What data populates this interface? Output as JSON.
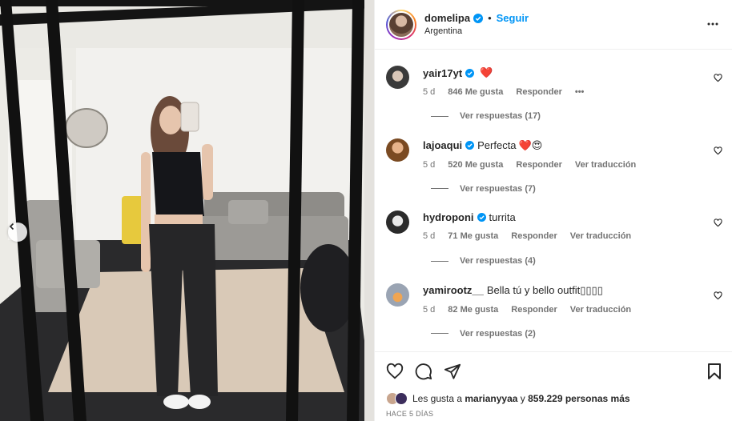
{
  "post": {
    "username": "domelipa",
    "follow_label": "Seguir",
    "separator": "•",
    "location": "Argentina"
  },
  "comments": [
    {
      "username": "yair17yt",
      "text": "",
      "emojis": "❤️",
      "time": "5 d",
      "likes": "846 Me gusta",
      "reply": "Responder",
      "translate": "",
      "more": "•••",
      "replies": "Ver respuestas (17)"
    },
    {
      "username": "lajoaqui",
      "text": "Perfecta",
      "emojis": "❤️😍",
      "time": "5 d",
      "likes": "520 Me gusta",
      "reply": "Responder",
      "translate": "Ver traducción",
      "more": "",
      "replies": "Ver respuestas (7)"
    },
    {
      "username": "hydroponi",
      "text": "turrita",
      "emojis": "",
      "time": "5 d",
      "likes": "71 Me gusta",
      "reply": "Responder",
      "translate": "Ver traducción",
      "more": "",
      "replies": "Ver respuestas (4)"
    },
    {
      "username": "yamirootz__",
      "text": "Bella tú y bello outfit▯▯▯▯",
      "emojis": "",
      "time": "5 d",
      "likes": "82 Me gusta",
      "reply": "Responder",
      "translate": "Ver traducción",
      "more": "",
      "replies": "Ver respuestas (2)"
    }
  ],
  "likes": {
    "prefix": "Les gusta a",
    "user": "marianyyaa",
    "conj": "y",
    "count": "859.229 personas más"
  },
  "date": "HACE 5 DÍAS",
  "colors": {
    "link": "#0095f6",
    "verified": "#0095f6",
    "heart": "#ed1c24"
  },
  "icons": [
    "verified-icon",
    "more-options-icon",
    "heart-icon",
    "comment-icon",
    "share-icon",
    "bookmark-icon",
    "chevron-left-icon"
  ]
}
